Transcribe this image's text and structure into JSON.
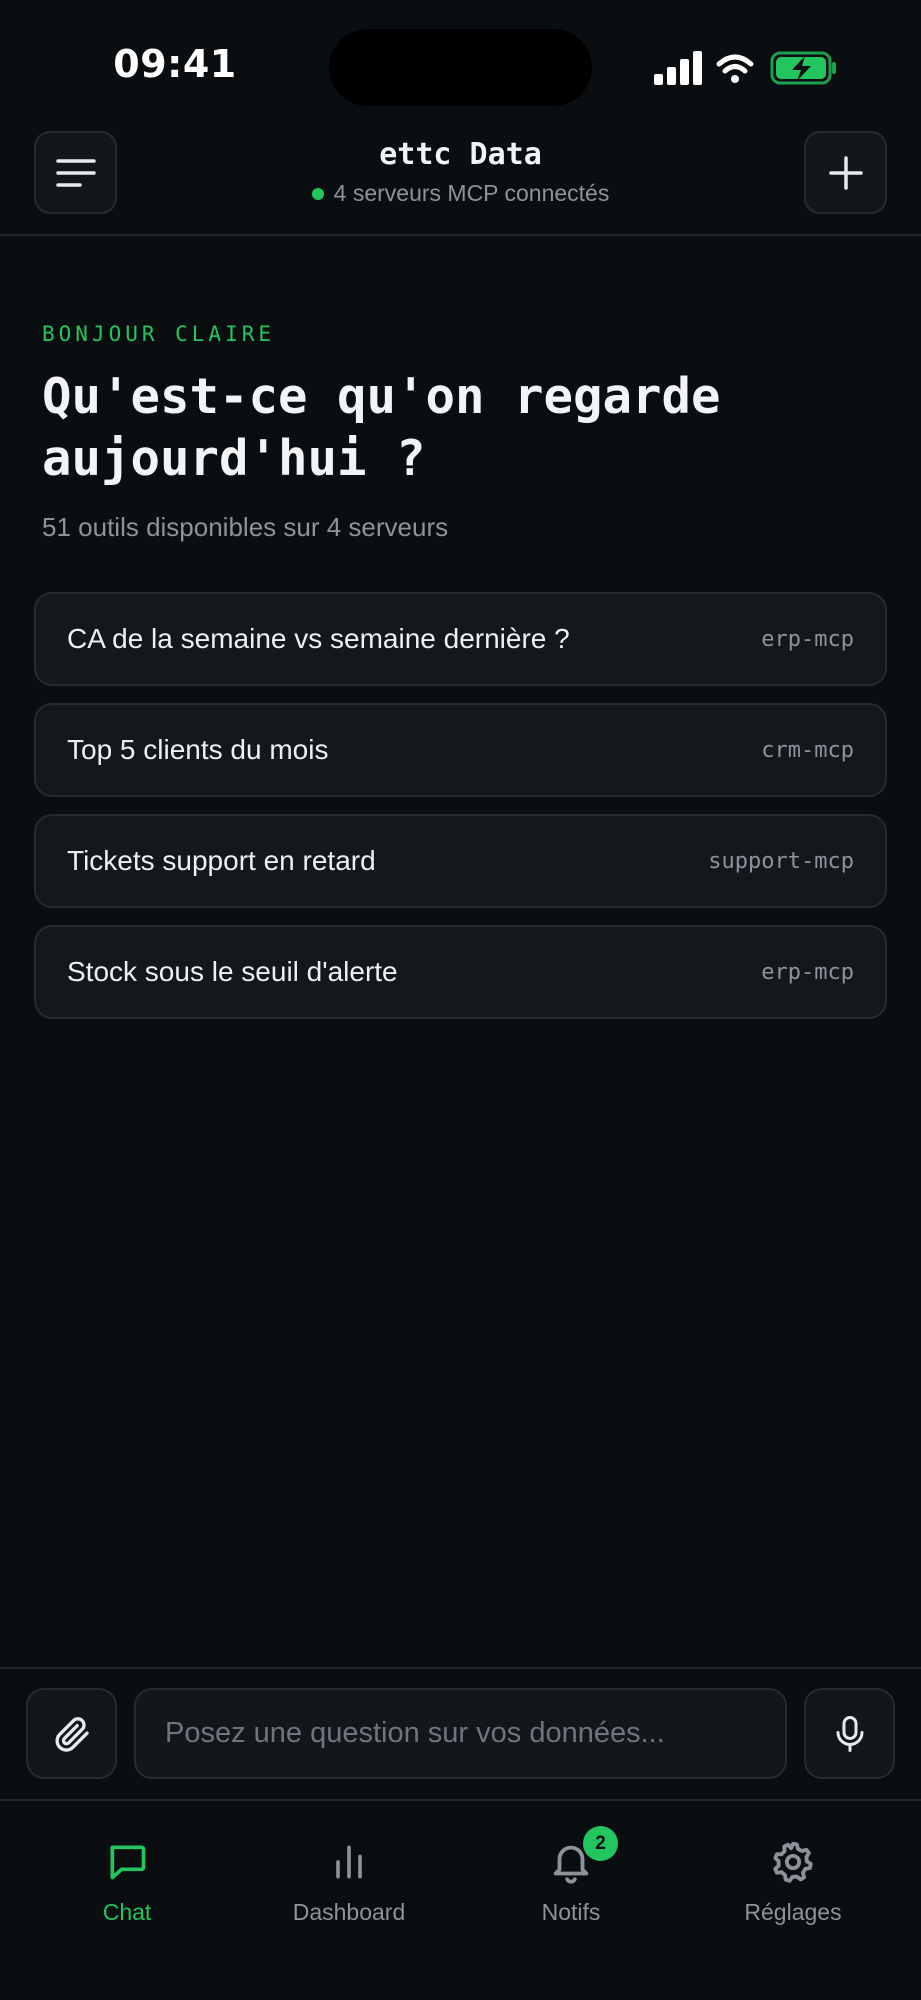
{
  "status_bar": {
    "time": "09:41"
  },
  "header": {
    "title": "ettc Data",
    "subtitle": "4 serveurs MCP connectés"
  },
  "hero": {
    "greeting": "BONJOUR CLAIRE",
    "headline": "Qu'est-ce qu'on regarde aujourd'hui ?",
    "subtitle": "51 outils disponibles sur 4 serveurs"
  },
  "suggestions": [
    {
      "text": "CA de la semaine vs semaine dernière ?",
      "tag": "erp-mcp"
    },
    {
      "text": "Top 5 clients du mois",
      "tag": "crm-mcp"
    },
    {
      "text": "Tickets support en retard",
      "tag": "support-mcp"
    },
    {
      "text": "Stock sous le seuil d'alerte",
      "tag": "erp-mcp"
    }
  ],
  "composer": {
    "placeholder": "Posez une question sur vos données...",
    "value": ""
  },
  "tabs": [
    {
      "label": "Chat",
      "icon": "chat-icon",
      "active": true
    },
    {
      "label": "Dashboard",
      "icon": "bar-chart-icon",
      "active": false
    },
    {
      "label": "Notifs",
      "icon": "bell-icon",
      "active": false,
      "badge": "2"
    },
    {
      "label": "Réglages",
      "icon": "gear-icon",
      "active": false
    }
  ],
  "colors": {
    "background": "#0b0e11",
    "accent": "#22c55e",
    "card": "#14181c",
    "border": "#262b31",
    "muted_text": "#8c939b"
  }
}
